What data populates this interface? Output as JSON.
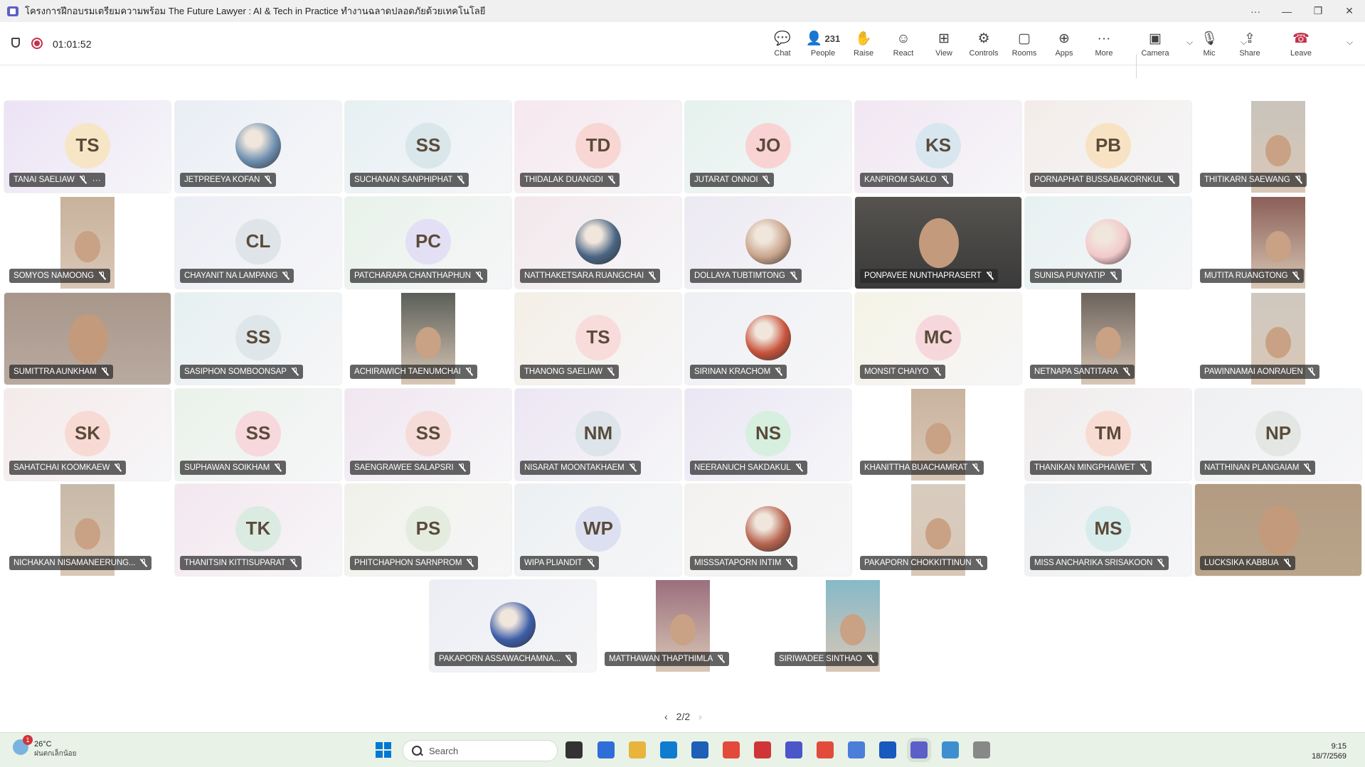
{
  "window": {
    "title": "โครงการฝึกอบรมเตรียมความพร้อม The Future Lawyer : AI & Tech in Practice ทำงานฉลาดปลอดภัยด้วยเทคโนโลยี",
    "controls": [
      "···",
      "—",
      "❐",
      "✕"
    ]
  },
  "meeting": {
    "timer": "01:01:52",
    "toolbar": [
      {
        "id": "chat",
        "label": "Chat",
        "icon": "chat-icon"
      },
      {
        "id": "people",
        "label": "People",
        "icon": "people-icon",
        "count": "231"
      },
      {
        "id": "raise",
        "label": "Raise",
        "icon": "hand-icon"
      },
      {
        "id": "react",
        "label": "React",
        "icon": "smile-icon"
      },
      {
        "id": "view",
        "label": "View",
        "icon": "grid-icon"
      },
      {
        "id": "controls",
        "label": "Controls",
        "icon": "controls-icon"
      },
      {
        "id": "rooms",
        "label": "Rooms",
        "icon": "rooms-icon"
      },
      {
        "id": "apps",
        "label": "Apps",
        "icon": "plus-icon"
      },
      {
        "id": "more",
        "label": "More",
        "icon": "ellipsis-icon"
      },
      {
        "id": "camera",
        "label": "Camera",
        "icon": "camera-off-icon"
      },
      {
        "id": "mic",
        "label": "Mic",
        "icon": "mic-icon"
      },
      {
        "id": "share",
        "label": "Share",
        "icon": "share-icon"
      },
      {
        "id": "leave",
        "label": "Leave",
        "icon": "phone-hangup-icon"
      }
    ]
  },
  "participants": [
    {
      "name": "TANAI SAELIAW",
      "initials": "TS",
      "kind": "initials",
      "bg": "#ece3f6",
      "av": "#f7e6c6"
    },
    {
      "name": "JETPREEYA KOFAN",
      "kind": "photo-avatar",
      "bg": "#e9eef5",
      "av": "#6e8fb0"
    },
    {
      "name": "SUCHANAN SANPHIPHAT",
      "initials": "SS",
      "kind": "initials",
      "bg": "#e6f0f3",
      "av": "#d9e6ea"
    },
    {
      "name": "THIDALAK DUANGDI",
      "initials": "TD",
      "kind": "initials",
      "bg": "#f6e8ef",
      "av": "#f8d6d4"
    },
    {
      "name": "JUTARAT ONNOI",
      "initials": "JO",
      "kind": "initials",
      "bg": "#e5f2ee",
      "av": "#f9d3d3"
    },
    {
      "name": "KANPIROM SAKLO",
      "initials": "KS",
      "kind": "initials",
      "bg": "#f2e6f3",
      "av": "#d8e6ef"
    },
    {
      "name": "PORNAPHAT BUSSABAKORNKUL",
      "initials": "PB",
      "kind": "initials",
      "bg": "#f3ece9",
      "av": "#f7e2c4"
    },
    {
      "name": "THITIKARN SAEWANG",
      "kind": "video",
      "bg": "#ffffff",
      "vbg": "#c9c4bc"
    },
    {
      "name": "SOMYOS NAMOONG",
      "kind": "video",
      "bg": "#ffffff",
      "vbg": "#c8b29c"
    },
    {
      "name": "CHAYANIT NA LAMPANG",
      "initials": "CL",
      "kind": "initials",
      "bg": "#eceef6",
      "av": "#dfe4e9"
    },
    {
      "name": "PATCHARAPA CHANTHAPHUN",
      "initials": "PC",
      "kind": "initials",
      "bg": "#e8f2ea",
      "av": "#e3dff4"
    },
    {
      "name": "NATTHAKETSARA RUANGCHAI",
      "kind": "photo-avatar",
      "bg": "#f3e8ec",
      "av": "#4a6584"
    },
    {
      "name": "DOLLAYA TUBTIMTONG",
      "kind": "photo-avatar",
      "bg": "#ece9f2",
      "av": "#c9a58c"
    },
    {
      "name": "PONPAVEE NUNTHAPRASERT",
      "kind": "video-full",
      "bg": "#3a3a3a",
      "vbg": "#56534f"
    },
    {
      "name": "SUNISA PUNYATIP",
      "kind": "photo-avatar",
      "bg": "#e7f1f1",
      "av": "#f3c9cc"
    },
    {
      "name": "MUTITA RUANGTONG",
      "kind": "video",
      "bg": "#ffffff",
      "vbg": "#8a5f57"
    },
    {
      "name": "SUMITTRA AUNKHAM",
      "kind": "video-full",
      "bg": "#b9aaa0",
      "vbg": "#a8968a"
    },
    {
      "name": "SASIPHON SOMBOONSAP",
      "initials": "SS",
      "kind": "initials",
      "bg": "#e6f0f1",
      "av": "#dfe6ea"
    },
    {
      "name": "ACHIRAWICH TAENUMCHAI",
      "kind": "video",
      "bg": "#ffffff",
      "vbg": "#5b5f58"
    },
    {
      "name": "THANONG SAELIAW",
      "initials": "TS",
      "kind": "initials",
      "bg": "#f4efe6",
      "av": "#f8dcdc"
    },
    {
      "name": "SIRINAN KRACHOM",
      "kind": "photo-avatar",
      "bg": "#eef0f4",
      "av": "#c8533c"
    },
    {
      "name": "MONSIT CHAIYO",
      "initials": "MC",
      "kind": "initials",
      "bg": "#f5f3e6",
      "av": "#f6d8dc"
    },
    {
      "name": "NETNAPA SANTITARA",
      "kind": "video",
      "bg": "#ffffff",
      "vbg": "#6b625c"
    },
    {
      "name": "PAWINNAMAI AONRAUEN",
      "kind": "video",
      "bg": "#ffffff",
      "vbg": "#cfc8c0"
    },
    {
      "name": "SAHATCHAI KOOMKAEW",
      "initials": "SK",
      "kind": "initials",
      "bg": "#f5eaea",
      "av": "#f8dad4"
    },
    {
      "name": "SUPHAWAN SOIKHAM",
      "initials": "SS",
      "kind": "initials",
      "bg": "#eaf2ea",
      "av": "#f6d8dd"
    },
    {
      "name": "SAENGRAWEE SALAPSRI",
      "initials": "SS",
      "kind": "initials",
      "bg": "#f1e6f1",
      "av": "#f6dcd9"
    },
    {
      "name": "NISARAT MOONTAKHAEM",
      "initials": "NM",
      "kind": "initials",
      "bg": "#ece6f3",
      "av": "#dde4ea"
    },
    {
      "name": "NEERANUCH SAKDAKUL",
      "initials": "NS",
      "kind": "initials",
      "bg": "#eae6f4",
      "av": "#d7efdf"
    },
    {
      "name": "KHANITTHA BUACHAMRAT",
      "kind": "video",
      "bg": "#ffffff",
      "vbg": "#c9b39f"
    },
    {
      "name": "THANIKAN MINGPHAIWET",
      "initials": "TM",
      "kind": "initials",
      "bg": "#f1ecec",
      "av": "#f8dcd4"
    },
    {
      "name": "NATTHINAN PLANGAIAM",
      "initials": "NP",
      "kind": "initials",
      "bg": "#eef0f2",
      "av": "#e3e6e3"
    },
    {
      "name": "NICHAKAN NISAMANEERUNG...",
      "kind": "video",
      "bg": "#ffffff",
      "vbg": "#c7b9a8"
    },
    {
      "name": "THANITSIN KITTISUPARAT",
      "initials": "TK",
      "kind": "initials",
      "bg": "#f4e7ef",
      "av": "#dcebe2"
    },
    {
      "name": "PHITCHAPHON SARNPROM",
      "initials": "PS",
      "kind": "initials",
      "bg": "#f1f1ea",
      "av": "#e4ecdf"
    },
    {
      "name": "WIPA PLIANDIT",
      "initials": "WP",
      "kind": "initials",
      "bg": "#ecf0f2",
      "av": "#dce0f1"
    },
    {
      "name": "MISSSATAPORN INTIM",
      "kind": "photo-avatar",
      "bg": "#f4f2ef",
      "av": "#b7644f"
    },
    {
      "name": "PAKAPORN CHOKKITTINUN",
      "kind": "video",
      "bg": "#ffffff",
      "vbg": "#d8ccc0"
    },
    {
      "name": "MISS ANCHARIKA SRISAKOON",
      "initials": "MS",
      "kind": "initials",
      "bg": "#ebeef0",
      "av": "#d8ecec"
    },
    {
      "name": "LUCKSIKA KABBUA",
      "kind": "video-full",
      "bg": "#b9a48a",
      "vbg": "#b29b82"
    },
    {
      "name": "PAKAPORN ASSAWACHAMNA...",
      "kind": "photo-avatar",
      "bg": "#eceef4",
      "av": "#3d5ea8"
    },
    {
      "name": "MATTHAWAN THAPTHIMLA",
      "kind": "video",
      "bg": "#ffffff",
      "vbg": "#9b6f7d"
    },
    {
      "name": "SIRIWADEE SINTHAO",
      "kind": "video",
      "bg": "#ffffff",
      "vbg": "#86b9c8"
    }
  ],
  "pager": {
    "label": "2/2"
  },
  "taskbar": {
    "weather_temp": "26°C",
    "weather_desc": "ฝนตกเล็กน้อย",
    "weather_badge": "1",
    "search_placeholder": "Search",
    "time": "9:15",
    "date": "18/7/2569",
    "app_colors": [
      "#333333",
      "#2f6ed8",
      "#e8b43c",
      "#0f7ccf",
      "#1e5fb8",
      "#e24b3b",
      "#d13438",
      "#4a56c9",
      "#e24b3b",
      "#4a7ed8",
      "#185abd",
      "#5b5fc7",
      "#3d8fd0",
      "#888888"
    ]
  }
}
